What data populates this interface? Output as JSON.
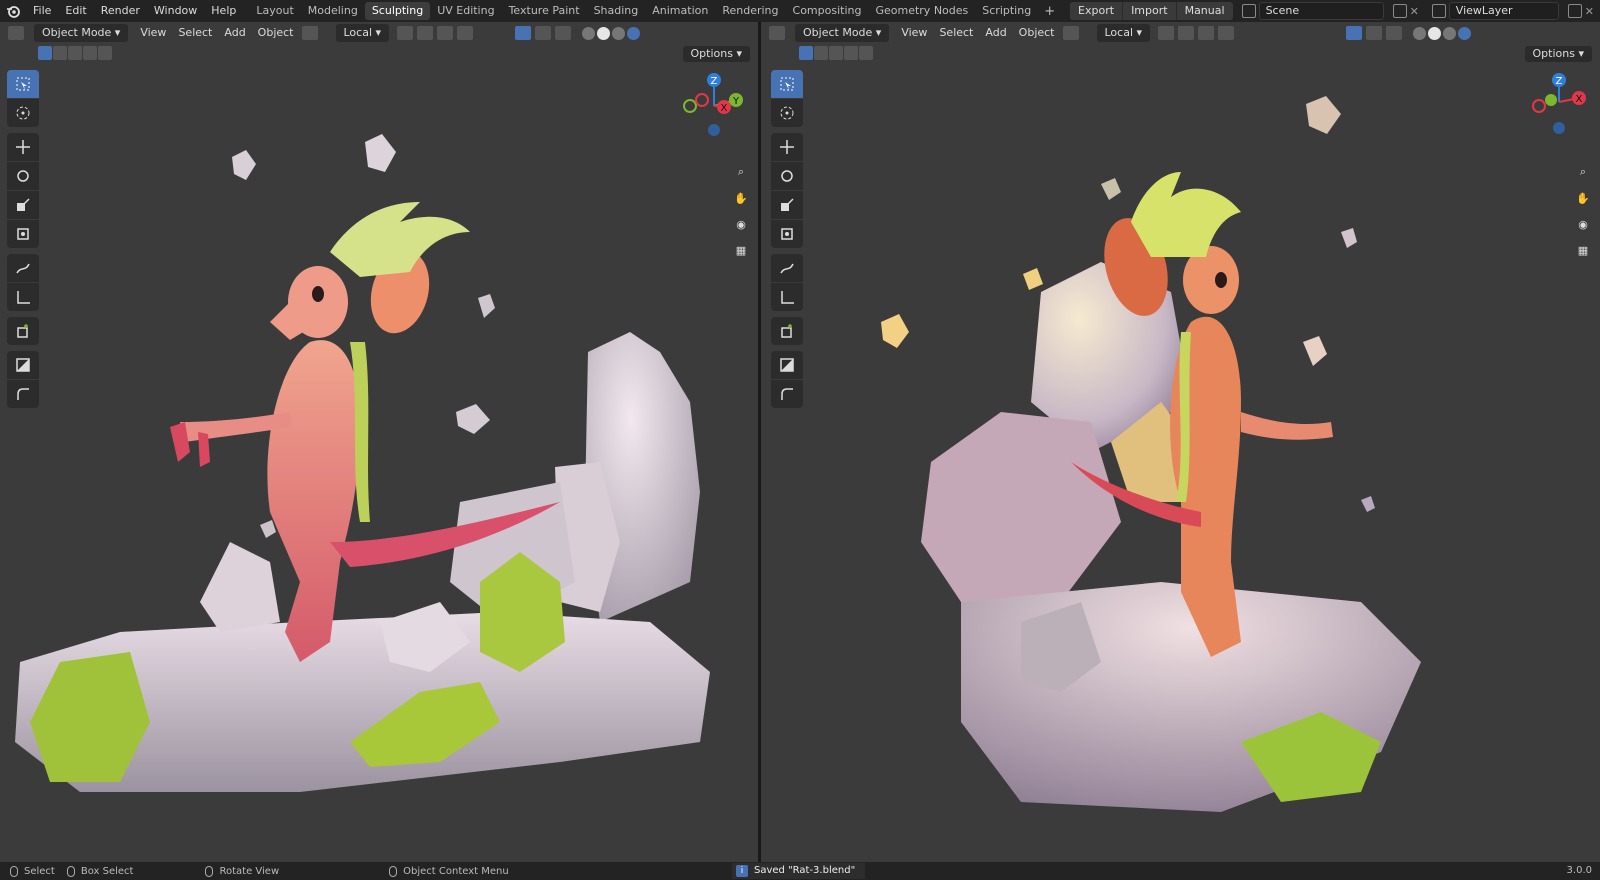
{
  "menu": [
    "File",
    "Edit",
    "Render",
    "Window",
    "Help"
  ],
  "workspaces": [
    {
      "label": "Layout",
      "active": false
    },
    {
      "label": "Modeling",
      "active": false
    },
    {
      "label": "Sculpting",
      "active": true
    },
    {
      "label": "UV Editing",
      "active": false
    },
    {
      "label": "Texture Paint",
      "active": false
    },
    {
      "label": "Shading",
      "active": false
    },
    {
      "label": "Animation",
      "active": false
    },
    {
      "label": "Rendering",
      "active": false
    },
    {
      "label": "Compositing",
      "active": false
    },
    {
      "label": "Geometry Nodes",
      "active": false
    },
    {
      "label": "Scripting",
      "active": false
    }
  ],
  "topright": {
    "export": "Export",
    "import": "Import",
    "manual": "Manual",
    "scene": "Scene",
    "viewlayer": "ViewLayer"
  },
  "viewport": {
    "mode": "Object Mode",
    "view": "View",
    "select": "Select",
    "add": "Add",
    "object": "Object",
    "transform_orientation": "Local",
    "options": "Options"
  },
  "status": {
    "select": "Select",
    "box_select": "Box Select",
    "rotate_view": "Rotate View",
    "context_menu": "Object Context Menu",
    "saved": "Saved \"Rat-3.blend\"",
    "version": "3.0.0"
  },
  "gizmo": {
    "z": "Z",
    "y": "Y",
    "x": "X"
  },
  "colors": {
    "accent": "#4772b3",
    "header": "#232323",
    "viewport": "#3b3b3b",
    "x_axis": "#e2364a",
    "y_axis": "#7cb82f",
    "z_axis": "#2f7fdc"
  }
}
